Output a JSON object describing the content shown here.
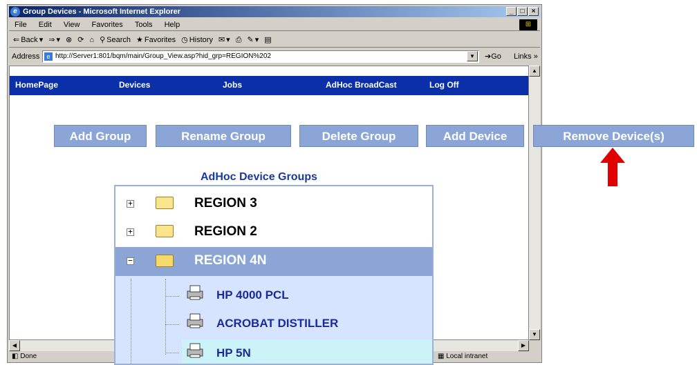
{
  "window": {
    "title": "Group Devices - Microsoft Internet Explorer",
    "menu": [
      "File",
      "Edit",
      "View",
      "Favorites",
      "Tools",
      "Help"
    ],
    "toolbar": {
      "back": "Back",
      "search": "Search",
      "favorites": "Favorites",
      "history": "History"
    },
    "address_label": "Address",
    "address_url": "http://Server1:801/bqm/main/Group_View.asp?hid_grp=REGION%202",
    "go_label": "Go",
    "links_label": "Links",
    "status_text": "Done",
    "zone_text": "Local intranet"
  },
  "nav": {
    "items": [
      "HomePage",
      "Devices",
      "Jobs",
      "AdHoc BroadCast",
      "Log Off"
    ]
  },
  "actions": {
    "add_group": "Add Group",
    "rename_group": "Rename Group",
    "delete_group": "Delete Group",
    "add_device": "Add Device",
    "remove_devices": "Remove Device(s)"
  },
  "groups_heading": "AdHoc Device Groups",
  "tree": {
    "groups": [
      {
        "label": "REGION 3",
        "expanded": false
      },
      {
        "label": "REGION 2",
        "expanded": false
      },
      {
        "label": "REGION 4N",
        "expanded": true
      }
    ],
    "devices": [
      "HP 4000 PCL",
      "ACROBAT DISTILLER",
      "HP 5N"
    ]
  },
  "colors": {
    "nav_bg": "#0b2fa8",
    "button_bg": "#8ba6d6",
    "selected_group_bg": "#8ba6d6",
    "device_row_bg": "#d6e4ff",
    "highlight_row_bg": "#ccf4f8",
    "arrow": "#e00000"
  }
}
